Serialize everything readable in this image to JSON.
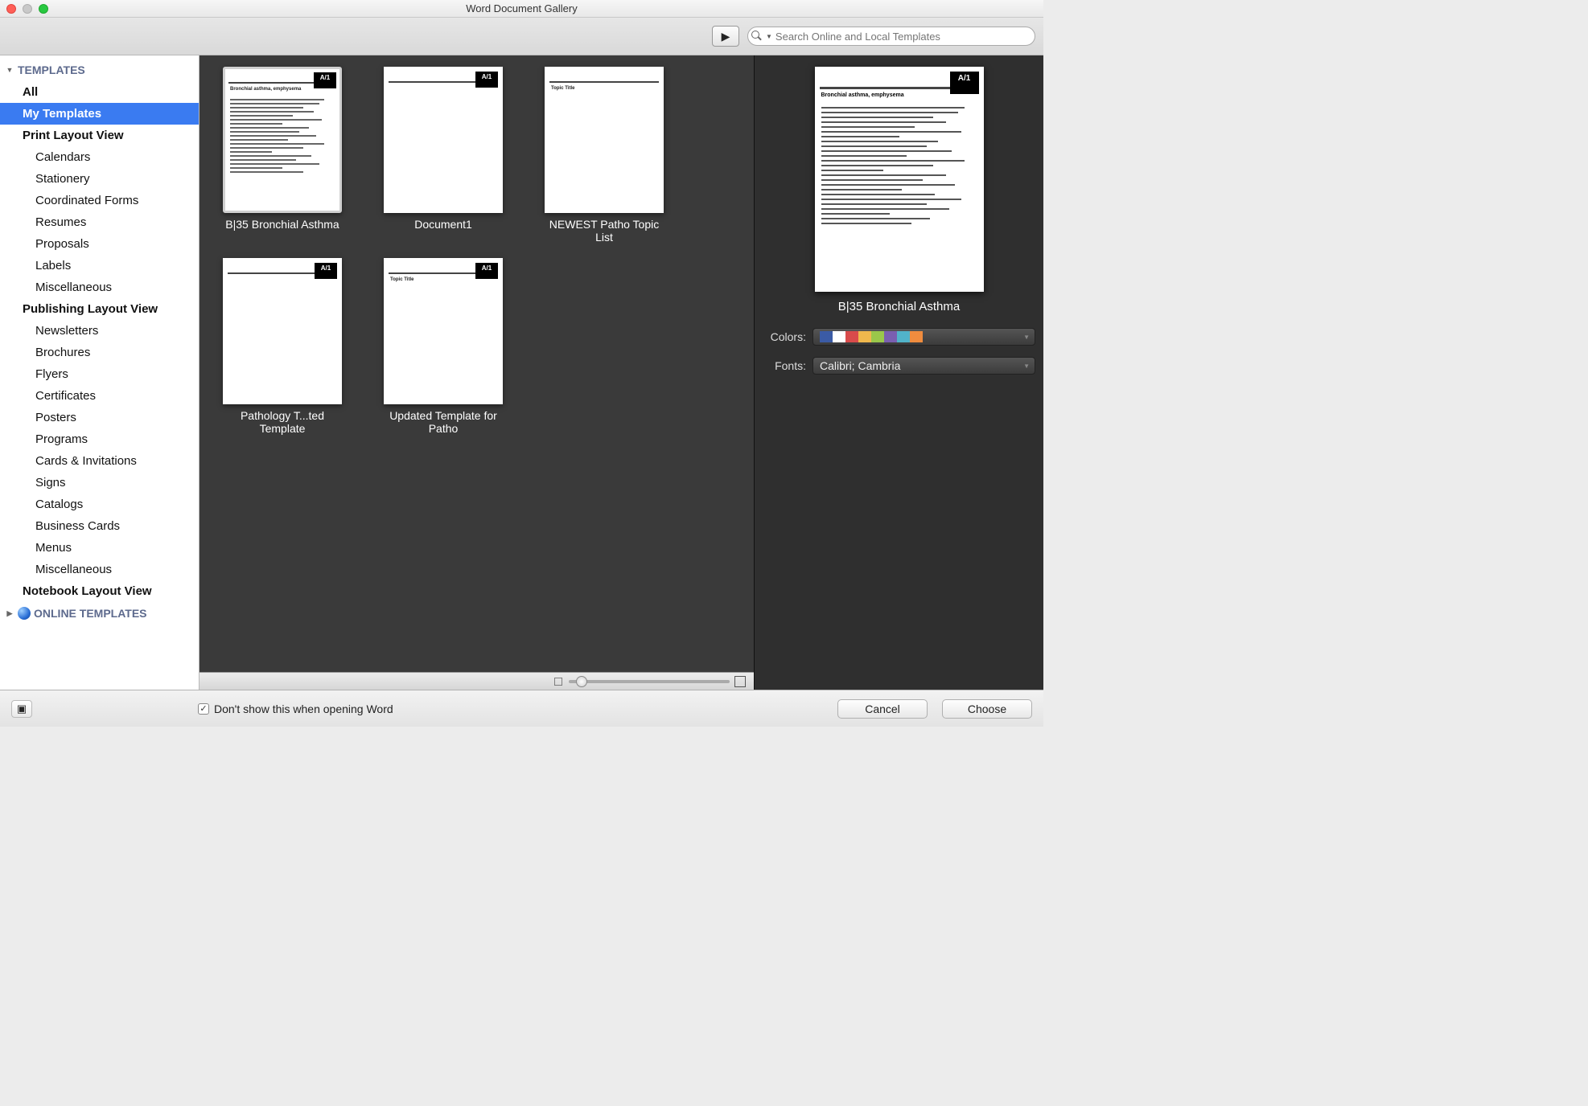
{
  "window": {
    "title": "Word Document Gallery"
  },
  "search": {
    "placeholder": "Search Online and Local Templates"
  },
  "sidebar": {
    "templates_header": "TEMPLATES",
    "all": "All",
    "my_templates": "My Templates",
    "print_layout": "Print Layout View",
    "print_children": [
      "Calendars",
      "Stationery",
      "Coordinated Forms",
      "Resumes",
      "Proposals",
      "Labels",
      "Miscellaneous"
    ],
    "publishing_layout": "Publishing Layout View",
    "publishing_children": [
      "Newsletters",
      "Brochures",
      "Flyers",
      "Certificates",
      "Posters",
      "Programs",
      "Cards & Invitations",
      "Signs",
      "Catalogs",
      "Business Cards",
      "Menus",
      "Miscellaneous"
    ],
    "notebook_layout": "Notebook Layout View",
    "online_templates_header": "ONLINE TEMPLATES"
  },
  "templates": [
    {
      "label": "B|35 Bronchial Asthma",
      "selected": true,
      "topic": "Bronchial asthma, emphysema",
      "badge": "A/1",
      "dense": true
    },
    {
      "label": "Document1",
      "selected": false,
      "topic": "",
      "badge": "A/1",
      "dense": false
    },
    {
      "label": "NEWEST Patho Topic List",
      "selected": false,
      "topic": "Topic Title",
      "badge": "",
      "dense": false
    },
    {
      "label": "Pathology T...ted Template",
      "selected": false,
      "topic": "",
      "badge": "A/1",
      "dense": false
    },
    {
      "label": "Updated Template for Patho",
      "selected": false,
      "topic": "Topic Title",
      "badge": "A/1",
      "dense": false
    }
  ],
  "preview": {
    "label": "B|35 Bronchial Asthma",
    "topic": "Bronchial asthma, emphysema",
    "badge": "A/1"
  },
  "options": {
    "colors_label": "Colors:",
    "fonts_label": "Fonts:",
    "fonts_value": "Calibri; Cambria",
    "swatches": [
      "#3b5ba5",
      "#ffffff",
      "#d94b4b",
      "#f0b84d",
      "#9ac74a",
      "#7a5fb0",
      "#51b3c9",
      "#f08c3e"
    ]
  },
  "footer": {
    "checkbox_label": "Don't show this when opening Word",
    "checked": true,
    "cancel": "Cancel",
    "choose": "Choose"
  }
}
